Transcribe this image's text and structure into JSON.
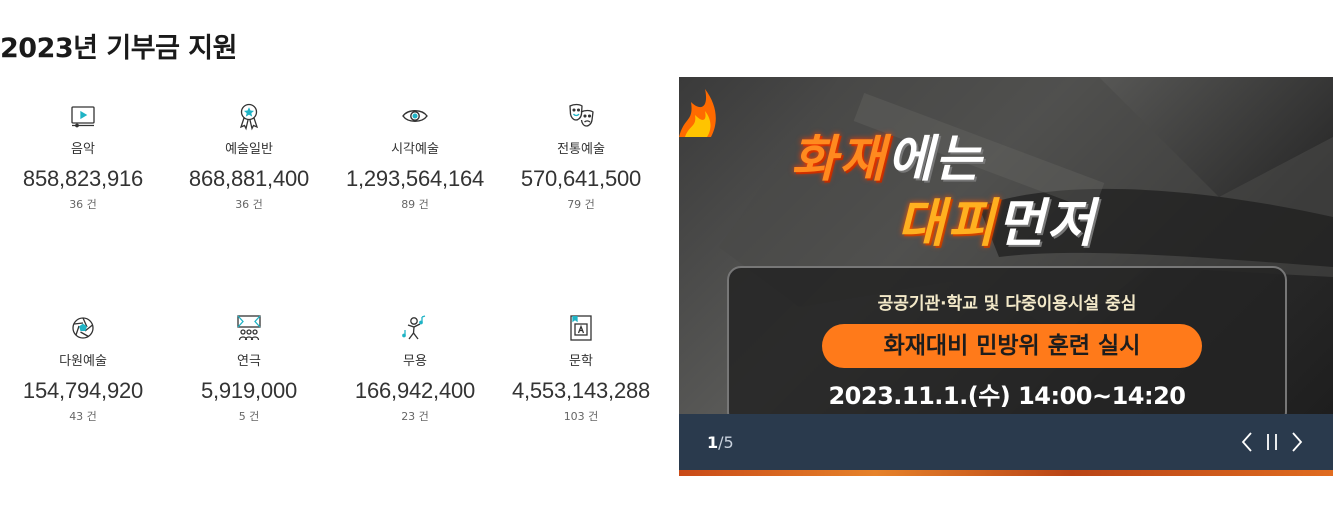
{
  "section": {
    "title": "2023년 기부금 지원"
  },
  "stats": [
    {
      "icon": "video-icon",
      "label": "음악",
      "amount": "858,823,916",
      "count": "36 건"
    },
    {
      "icon": "award-ribbon-icon",
      "label": "예술일반",
      "amount": "868,881,400",
      "count": "36 건"
    },
    {
      "icon": "eye-icon",
      "label": "시각예술",
      "amount": "1,293,564,164",
      "count": "89 건"
    },
    {
      "icon": "theater-masks-icon",
      "label": "전통예술",
      "amount": "570,641,500",
      "count": "79 건"
    },
    {
      "icon": "aperture-icon",
      "label": "다원예술",
      "amount": "154,794,920",
      "count": "43 건"
    },
    {
      "icon": "stage-audience-icon",
      "label": "연극",
      "amount": "5,919,000",
      "count": "5 건"
    },
    {
      "icon": "dancer-music-icon",
      "label": "무용",
      "amount": "166,942,400",
      "count": "23 건"
    },
    {
      "icon": "book-letter-icon",
      "label": "문학",
      "amount": "4,553,143,288",
      "count": "103 건"
    }
  ],
  "banner": {
    "headline_line1_a": "화재",
    "headline_line1_b": "에는",
    "headline_line2_a": "대피",
    "headline_line2_b": "먼저",
    "subtitle": "공공기관·학교 및 다중이용시설 중심",
    "pill_text": "화재대비 민방위 훈련 실시",
    "date_text": "2023.11.1.(수) 14:00~14:20",
    "colors": {
      "accent": "#ff7a1a",
      "bar": "#2a3a4d"
    }
  },
  "slider": {
    "current": "1",
    "total": "/5",
    "prev_icon": "chevron-left-icon",
    "pause_icon": "pause-icon",
    "next_icon": "chevron-right-icon"
  }
}
